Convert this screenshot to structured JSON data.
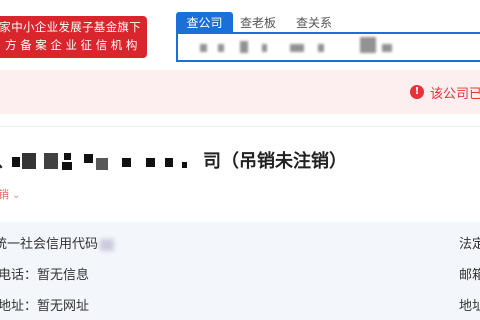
{
  "header": {
    "badge_line1": "家中小企业发展子基金旗下",
    "badge_line2": "方备案企业征信机构",
    "tabs": [
      {
        "label": "查公司",
        "active": true
      },
      {
        "label": "查老板",
        "active": false
      },
      {
        "label": "查关系",
        "active": false
      }
    ],
    "search_value_pixelated": true
  },
  "alert": {
    "icon": "warning-icon",
    "text": "该公司已",
    "color": "#e5333a"
  },
  "company": {
    "name_visible_part": "司",
    "name_prefix_partial": "科",
    "status_text": "（吊销未注销）",
    "tag_label": "销",
    "tag_icon": "chevron-down-icon"
  },
  "info": {
    "rows": [
      {
        "label": "统一社会信用代码",
        "right_label": "法定"
      },
      {
        "label": "电话：暂无信息",
        "right_label": "邮箱"
      },
      {
        "label": "地址：暂无网址",
        "right_label": "地址"
      }
    ]
  },
  "colors": {
    "brand_red": "#d9252c",
    "tab_blue": "#1a6fd8",
    "alert_bg": "#fdeff0",
    "info_bg": "#f3f7fb"
  }
}
